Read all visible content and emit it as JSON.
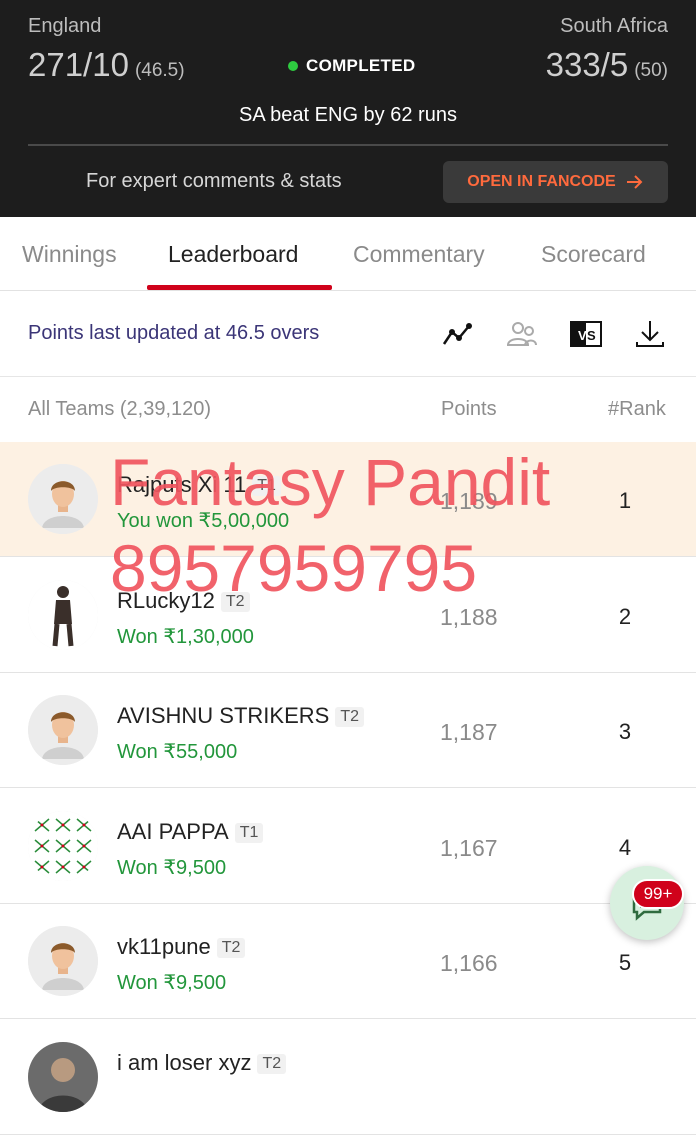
{
  "match": {
    "team1": {
      "name": "England",
      "score": "271/10",
      "overs": "(46.5)"
    },
    "team2": {
      "name": "South Africa",
      "score": "333/5",
      "overs": "(50)"
    },
    "status": "COMPLETED",
    "result": "SA beat ENG by 62 runs",
    "expert_text": "For expert comments & stats",
    "fancode_button": "OPEN IN FANCODE"
  },
  "tabs": [
    "Winnings",
    "Leaderboard",
    "Commentary",
    "Scorecard"
  ],
  "active_tab": "Leaderboard",
  "updated_text": "Points last updated at 46.5 overs",
  "table": {
    "col_teams": "All Teams (2,39,120)",
    "col_points": "Points",
    "col_rank": "#Rank",
    "rows": [
      {
        "name": "Rajputs Xi 11",
        "tag": "T1",
        "won": "You won ₹5,00,000",
        "points": "1,189",
        "rank": "1",
        "avatar": "person"
      },
      {
        "name": "RLucky12",
        "tag": "T2",
        "won": "Won ₹1,30,000",
        "points": "1,188",
        "rank": "2",
        "avatar": "figure"
      },
      {
        "name": "AVISHNU STRIKERS",
        "tag": "T2",
        "won": "Won ₹55,000",
        "points": "1,187",
        "rank": "3",
        "avatar": "person"
      },
      {
        "name": "AAI    PAPPA",
        "tag": "T1",
        "won": "Won ₹9,500",
        "points": "1,167",
        "rank": "4",
        "avatar": "pattern"
      },
      {
        "name": "vk11pune",
        "tag": "T2",
        "won": "Won ₹9,500",
        "points": "1,166",
        "rank": "5",
        "avatar": "person"
      },
      {
        "name": "i am loser xyz",
        "tag": "T2",
        "won": "",
        "points": "",
        "rank": "",
        "avatar": "photo"
      }
    ]
  },
  "watermark": {
    "line1": "Fantasy Pandit",
    "line2": "8957959795"
  },
  "chat_badge": "99+",
  "colors": {
    "accent_red": "#d0021b",
    "win_green": "#22963b",
    "fancode_orange": "#ff6a3d",
    "header_bg": "#1d1d1d"
  }
}
